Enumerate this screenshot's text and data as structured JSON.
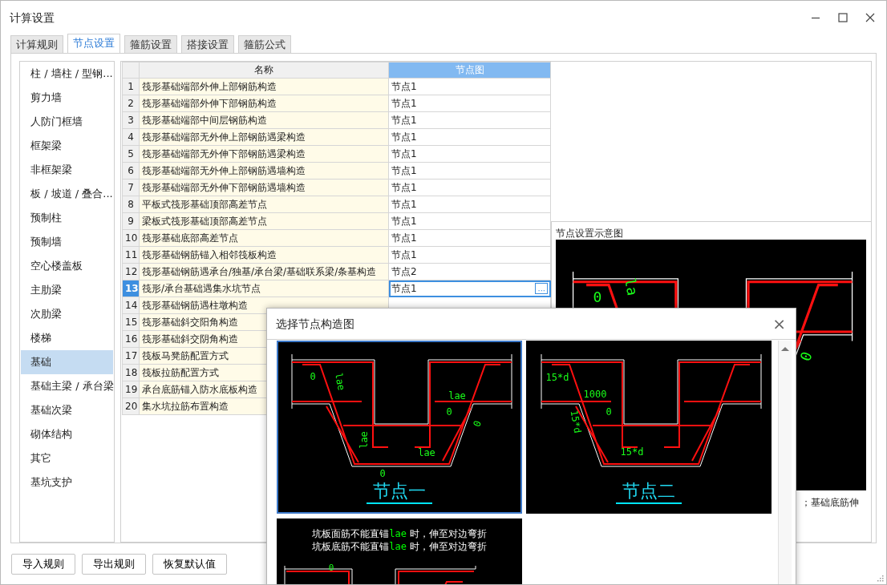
{
  "window": {
    "title": "计算设置"
  },
  "tabs": [
    {
      "label": "计算规则",
      "selected": false
    },
    {
      "label": "节点设置",
      "selected": true
    },
    {
      "label": "箍筋设置",
      "selected": false
    },
    {
      "label": "搭接设置",
      "selected": false
    },
    {
      "label": "箍筋公式",
      "selected": false
    }
  ],
  "sidebar": {
    "items": [
      {
        "label": "柱 / 墙柱 / 型钢...",
        "selected": false
      },
      {
        "label": "剪力墙",
        "selected": false
      },
      {
        "label": "人防门框墙",
        "selected": false
      },
      {
        "label": "框架梁",
        "selected": false
      },
      {
        "label": "非框架梁",
        "selected": false
      },
      {
        "label": "板 / 坡道 / 叠合...",
        "selected": false
      },
      {
        "label": "预制柱",
        "selected": false
      },
      {
        "label": "预制墙",
        "selected": false
      },
      {
        "label": "空心楼盖板",
        "selected": false
      },
      {
        "label": "主肋梁",
        "selected": false
      },
      {
        "label": "次肋梁",
        "selected": false
      },
      {
        "label": "楼梯",
        "selected": false
      },
      {
        "label": "基础",
        "selected": true
      },
      {
        "label": "基础主梁 / 承台梁",
        "selected": false
      },
      {
        "label": "基础次梁",
        "selected": false
      },
      {
        "label": "砌体结构",
        "selected": false
      },
      {
        "label": "其它",
        "selected": false
      },
      {
        "label": "基坑支护",
        "selected": false
      }
    ]
  },
  "table": {
    "columns": [
      {
        "label": "名称",
        "selected": false
      },
      {
        "label": "节点图",
        "selected": true
      }
    ],
    "rows": [
      {
        "number": "1",
        "name": "筏形基础端部外伸上部钢筋构造",
        "value": "节点1",
        "selected": false
      },
      {
        "number": "2",
        "name": "筏形基础端部外伸下部钢筋构造",
        "value": "节点1",
        "selected": false
      },
      {
        "number": "3",
        "name": "筏形基础端部中间层钢筋构造",
        "value": "节点1",
        "selected": false
      },
      {
        "number": "4",
        "name": "筏形基础端部无外伸上部钢筋遇梁构造",
        "value": "节点1",
        "selected": false
      },
      {
        "number": "5",
        "name": "筏形基础端部无外伸下部钢筋遇梁构造",
        "value": "节点1",
        "selected": false
      },
      {
        "number": "6",
        "name": "筏形基础端部无外伸上部钢筋遇墙构造",
        "value": "节点1",
        "selected": false
      },
      {
        "number": "7",
        "name": "筏形基础端部无外伸下部钢筋遇墙构造",
        "value": "节点1",
        "selected": false
      },
      {
        "number": "8",
        "name": "平板式筏形基础顶部高差节点",
        "value": "节点1",
        "selected": false
      },
      {
        "number": "9",
        "name": "梁板式筏形基础顶部高差节点",
        "value": "节点1",
        "selected": false
      },
      {
        "number": "10",
        "name": "筏形基础底部高差节点",
        "value": "节点1",
        "selected": false
      },
      {
        "number": "11",
        "name": "筏形基础钢筋锚入相邻筏板构造",
        "value": "节点1",
        "selected": false
      },
      {
        "number": "12",
        "name": "筏形基础钢筋遇承台/独基/承台梁/基础联系梁/条基构造",
        "value": "节点2",
        "selected": false
      },
      {
        "number": "13",
        "name": "筏形/承台基础遇集水坑节点",
        "value": "节点1",
        "selected": true,
        "picker_button": "···"
      },
      {
        "number": "14",
        "name": "筏形基础钢筋遇柱墩构造",
        "selected": false
      },
      {
        "number": "15",
        "name": "筏形基础斜交阳角构造",
        "selected": false
      },
      {
        "number": "16",
        "name": "筏形基础斜交阴角构造",
        "selected": false
      },
      {
        "number": "17",
        "name": "筏板马凳筋配置方式",
        "selected": false
      },
      {
        "number": "18",
        "name": "筏板拉筋配置方式",
        "selected": false
      },
      {
        "number": "19",
        "name": "承台底筋锚入防水底板构造",
        "selected": false
      },
      {
        "number": "20",
        "name": "集水坑拉筋布置构造",
        "selected": false
      }
    ]
  },
  "preview": {
    "title": "节点设置示意图",
    "labels": [
      "0",
      "la",
      "0"
    ],
    "caption": "；基础底筋伸"
  },
  "dialog": {
    "title": "选择节点构造图",
    "close": "×",
    "options": [
      {
        "kind": "drawing",
        "selected": true,
        "labels": [
          "0",
          "lae",
          "lae",
          "0",
          "lae",
          "lae",
          "0",
          "0"
        ],
        "caption": "节点一"
      },
      {
        "kind": "drawing",
        "selected": false,
        "labels": [
          "15*d",
          "1000",
          "0",
          "15*d",
          "15*d"
        ],
        "caption": "节点二"
      },
      {
        "kind": "notes",
        "selected": false,
        "lines": [
          {
            "before": "坑板面筋不能直锚",
            "term": "lae",
            "after": " 时，伸至对边弯折"
          },
          {
            "before": "坑板底筋不能直锚",
            "term": "lae",
            "after": " 时，伸至对边弯折"
          }
        ],
        "labels": [
          "0"
        ]
      }
    ]
  },
  "buttons": [
    "导入规则",
    "导出规则",
    "恢复默认值"
  ]
}
